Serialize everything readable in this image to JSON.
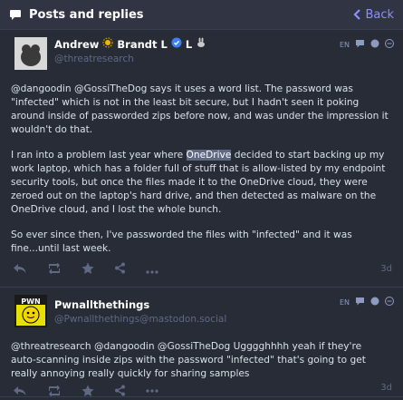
{
  "header": {
    "title": "Posts and replies",
    "back_label": "Back"
  },
  "colors": {
    "background": "#282c37",
    "accent": "#8c8dff",
    "muted": "#606984",
    "highlight": "#606984"
  },
  "posts": [
    {
      "display_name_1": "Andrew",
      "display_name_2": "Brandt L",
      "display_name_3": "L",
      "handle": "@threatresearch",
      "lang": "EN",
      "paragraph1": "@dangoodin @GossiTheDog says it uses a word list. The password was \"infected\" which is not in the least bit secure, but I hadn't seen it poking around inside of passworded zips before now, and was under the impression it wouldn't do that.",
      "p2_before": "I ran into a problem last year where ",
      "p2_highlight": "OneDrive",
      "p2_after": " decided to start backing up my work laptop, which has a folder full of stuff that is allow-listed by my endpoint security tools, but once the files made it to the OneDrive cloud, they were zeroed out on the laptop's hard drive, and then detected as malware on the OneDrive cloud, and I lost the whole bunch.",
      "paragraph3": "So ever since then, I've passworded the files with \"infected\" and it was fine...until last week.",
      "time": "3d"
    },
    {
      "display_name": "Pwnallthethings",
      "handle": "@Pwnallthethings@mastodon.social",
      "avatar_text": "PWN",
      "lang": "EN",
      "paragraph1": "@threatresearch @dangoodin @GossiTheDog Ugggghhhh yeah if they're auto-scanning inside zips with the password \"infected\" that's going to get really annoying really quickly for sharing samples",
      "time": "3d"
    }
  ]
}
